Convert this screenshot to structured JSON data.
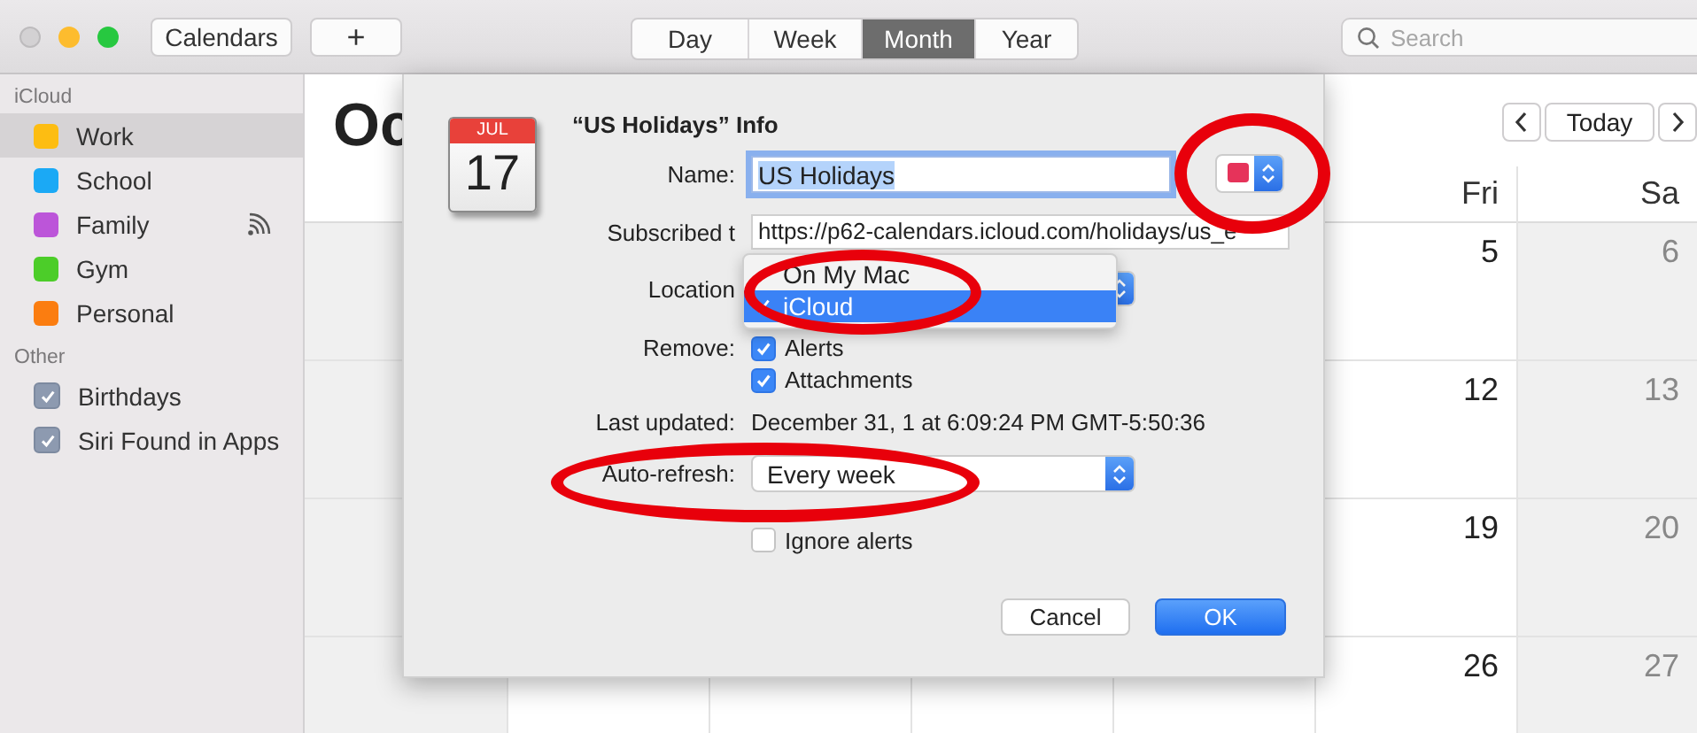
{
  "window_buttons": [
    {
      "kind": "close",
      "enabled": false
    },
    {
      "kind": "minimize",
      "enabled": true
    },
    {
      "kind": "zoom",
      "enabled": true
    }
  ],
  "toolbar": {
    "calendars_button": "Calendars",
    "add_button": "+",
    "views": [
      {
        "label": "Day",
        "selected": false
      },
      {
        "label": "Week",
        "selected": false
      },
      {
        "label": "Month",
        "selected": true
      },
      {
        "label": "Year",
        "selected": false
      }
    ],
    "search": {
      "placeholder": "Search"
    }
  },
  "sidebar": {
    "sections": [
      {
        "heading": "iCloud",
        "items": [
          {
            "kind": "color",
            "name": "Work",
            "color": "#fdbd12",
            "selected": true,
            "shared": false
          },
          {
            "kind": "color",
            "name": "School",
            "color": "#1ba9f5",
            "selected": false,
            "shared": false
          },
          {
            "kind": "color",
            "name": "Family",
            "color": "#bc55d9",
            "selected": false,
            "shared": true
          },
          {
            "kind": "color",
            "name": "Gym",
            "color": "#4ccd29",
            "selected": false,
            "shared": false
          },
          {
            "kind": "color",
            "name": "Personal",
            "color": "#fb7d10",
            "selected": false,
            "shared": false
          }
        ]
      },
      {
        "heading": "Other",
        "items": [
          {
            "kind": "checkbox",
            "name": "Birthdays",
            "checked": true,
            "selected": false
          },
          {
            "kind": "checkbox",
            "name": "Siri Found in Apps",
            "checked": true,
            "selected": false
          }
        ]
      }
    ]
  },
  "calendar": {
    "title": "Oc",
    "today_button": "Today",
    "columns": [
      {
        "weekend": true
      },
      {
        "weekend": false
      },
      {
        "weekend": false
      },
      {
        "weekend": false
      },
      {
        "weekend": false
      },
      {
        "header": "Fri",
        "weekend": false,
        "dates": [
          "5",
          "12",
          "19",
          "26"
        ]
      },
      {
        "header": "Sa",
        "weekend": true,
        "dates": [
          "6",
          "13",
          "20",
          "27"
        ]
      }
    ]
  },
  "dialog": {
    "icon": {
      "month": "JUL",
      "day": "17"
    },
    "title": "“US Holidays” Info",
    "name": {
      "label": "Name:",
      "value": "US Holidays",
      "value_selected": true,
      "color": "#e6335a",
      "circled": true
    },
    "subscribed": {
      "label": "Subscribed t",
      "value": "https://p62-calendars.icloud.com/holidays/us_e"
    },
    "location": {
      "label": "Location",
      "circled": true,
      "menu": [
        {
          "label": "On My Mac",
          "selected": false
        },
        {
          "label": "iCloud",
          "selected": true
        }
      ]
    },
    "remove": {
      "label": "Remove:",
      "options": [
        {
          "label": "Alerts",
          "checked": true
        },
        {
          "label": "Attachments",
          "checked": true
        }
      ]
    },
    "last_updated": {
      "label": "Last updated:",
      "value": "December 31, 1 at 6:09:24 PM GMT-5:50:36"
    },
    "auto_refresh": {
      "label": "Auto-refresh:",
      "value": "Every week",
      "circled": true
    },
    "ignore_alerts": {
      "label": "Ignore alerts",
      "checked": false
    },
    "buttons": [
      {
        "label": "Cancel",
        "kind": "normal"
      },
      {
        "label": "OK",
        "kind": "default"
      }
    ]
  }
}
